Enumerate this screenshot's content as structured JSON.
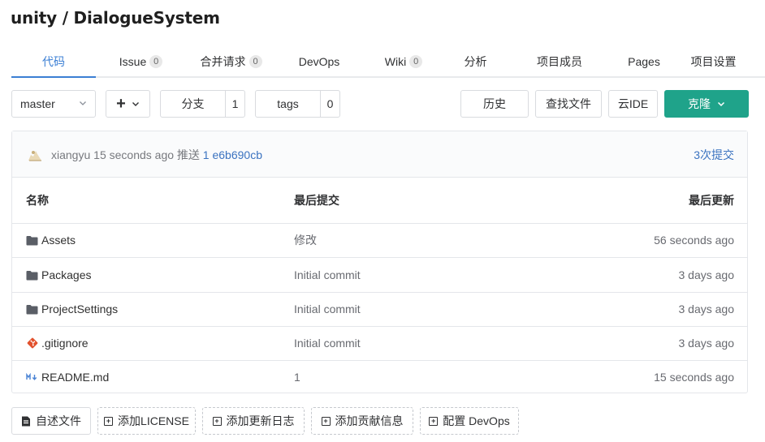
{
  "repo": {
    "title": "unity / DialogueSystem"
  },
  "tabs": [
    {
      "label": "代码",
      "count": null,
      "active": true
    },
    {
      "label": "Issue",
      "count": "0"
    },
    {
      "label": "合并请求",
      "count": "0"
    },
    {
      "label": "DevOps",
      "count": null
    },
    {
      "label": "Wiki",
      "count": "0"
    },
    {
      "label": "分析",
      "count": null
    },
    {
      "label": "项目成员",
      "count": null
    },
    {
      "label": "Pages",
      "count": null
    },
    {
      "label": "项目设置",
      "count": null
    }
  ],
  "toolbar": {
    "branch": "master",
    "plus": "+",
    "branches_label": "分支",
    "branches_count": "1",
    "tags_label": "tags",
    "tags_count": "0",
    "history": "历史",
    "find_file": "查找文件",
    "cloud_ide": "云IDE",
    "clone": "克隆"
  },
  "commit": {
    "author": "xiangyu",
    "time": "15 seconds ago",
    "action": "推送",
    "message": "1",
    "hash": "e6b690cb",
    "commits": "3次提交"
  },
  "table": {
    "headers": {
      "name": "名称",
      "last_commit": "最后提交",
      "last_update": "最后更新"
    },
    "rows": [
      {
        "icon": "folder-icon",
        "name": "Assets",
        "commit": "修改",
        "updated": "56 seconds ago"
      },
      {
        "icon": "folder-icon",
        "name": "Packages",
        "commit": "Initial commit",
        "updated": "3 days ago"
      },
      {
        "icon": "folder-icon",
        "name": "ProjectSettings",
        "commit": "Initial commit",
        "updated": "3 days ago"
      },
      {
        "icon": "git-icon",
        "name": ".gitignore",
        "commit": "Initial commit",
        "updated": "3 days ago"
      },
      {
        "icon": "markdown-icon",
        "name": "README.md",
        "commit": "1",
        "updated": "15 seconds ago"
      }
    ]
  },
  "actions": {
    "readme": "自述文件",
    "license": "添加LICENSE",
    "changelog": "添加更新日志",
    "contributing": "添加贡献信息",
    "devops": "配置 DevOps"
  },
  "colors": {
    "accent": "#3b7fd4",
    "clone": "#1fa38a",
    "git": "#e2512d",
    "markdown": "#4a83d4"
  }
}
